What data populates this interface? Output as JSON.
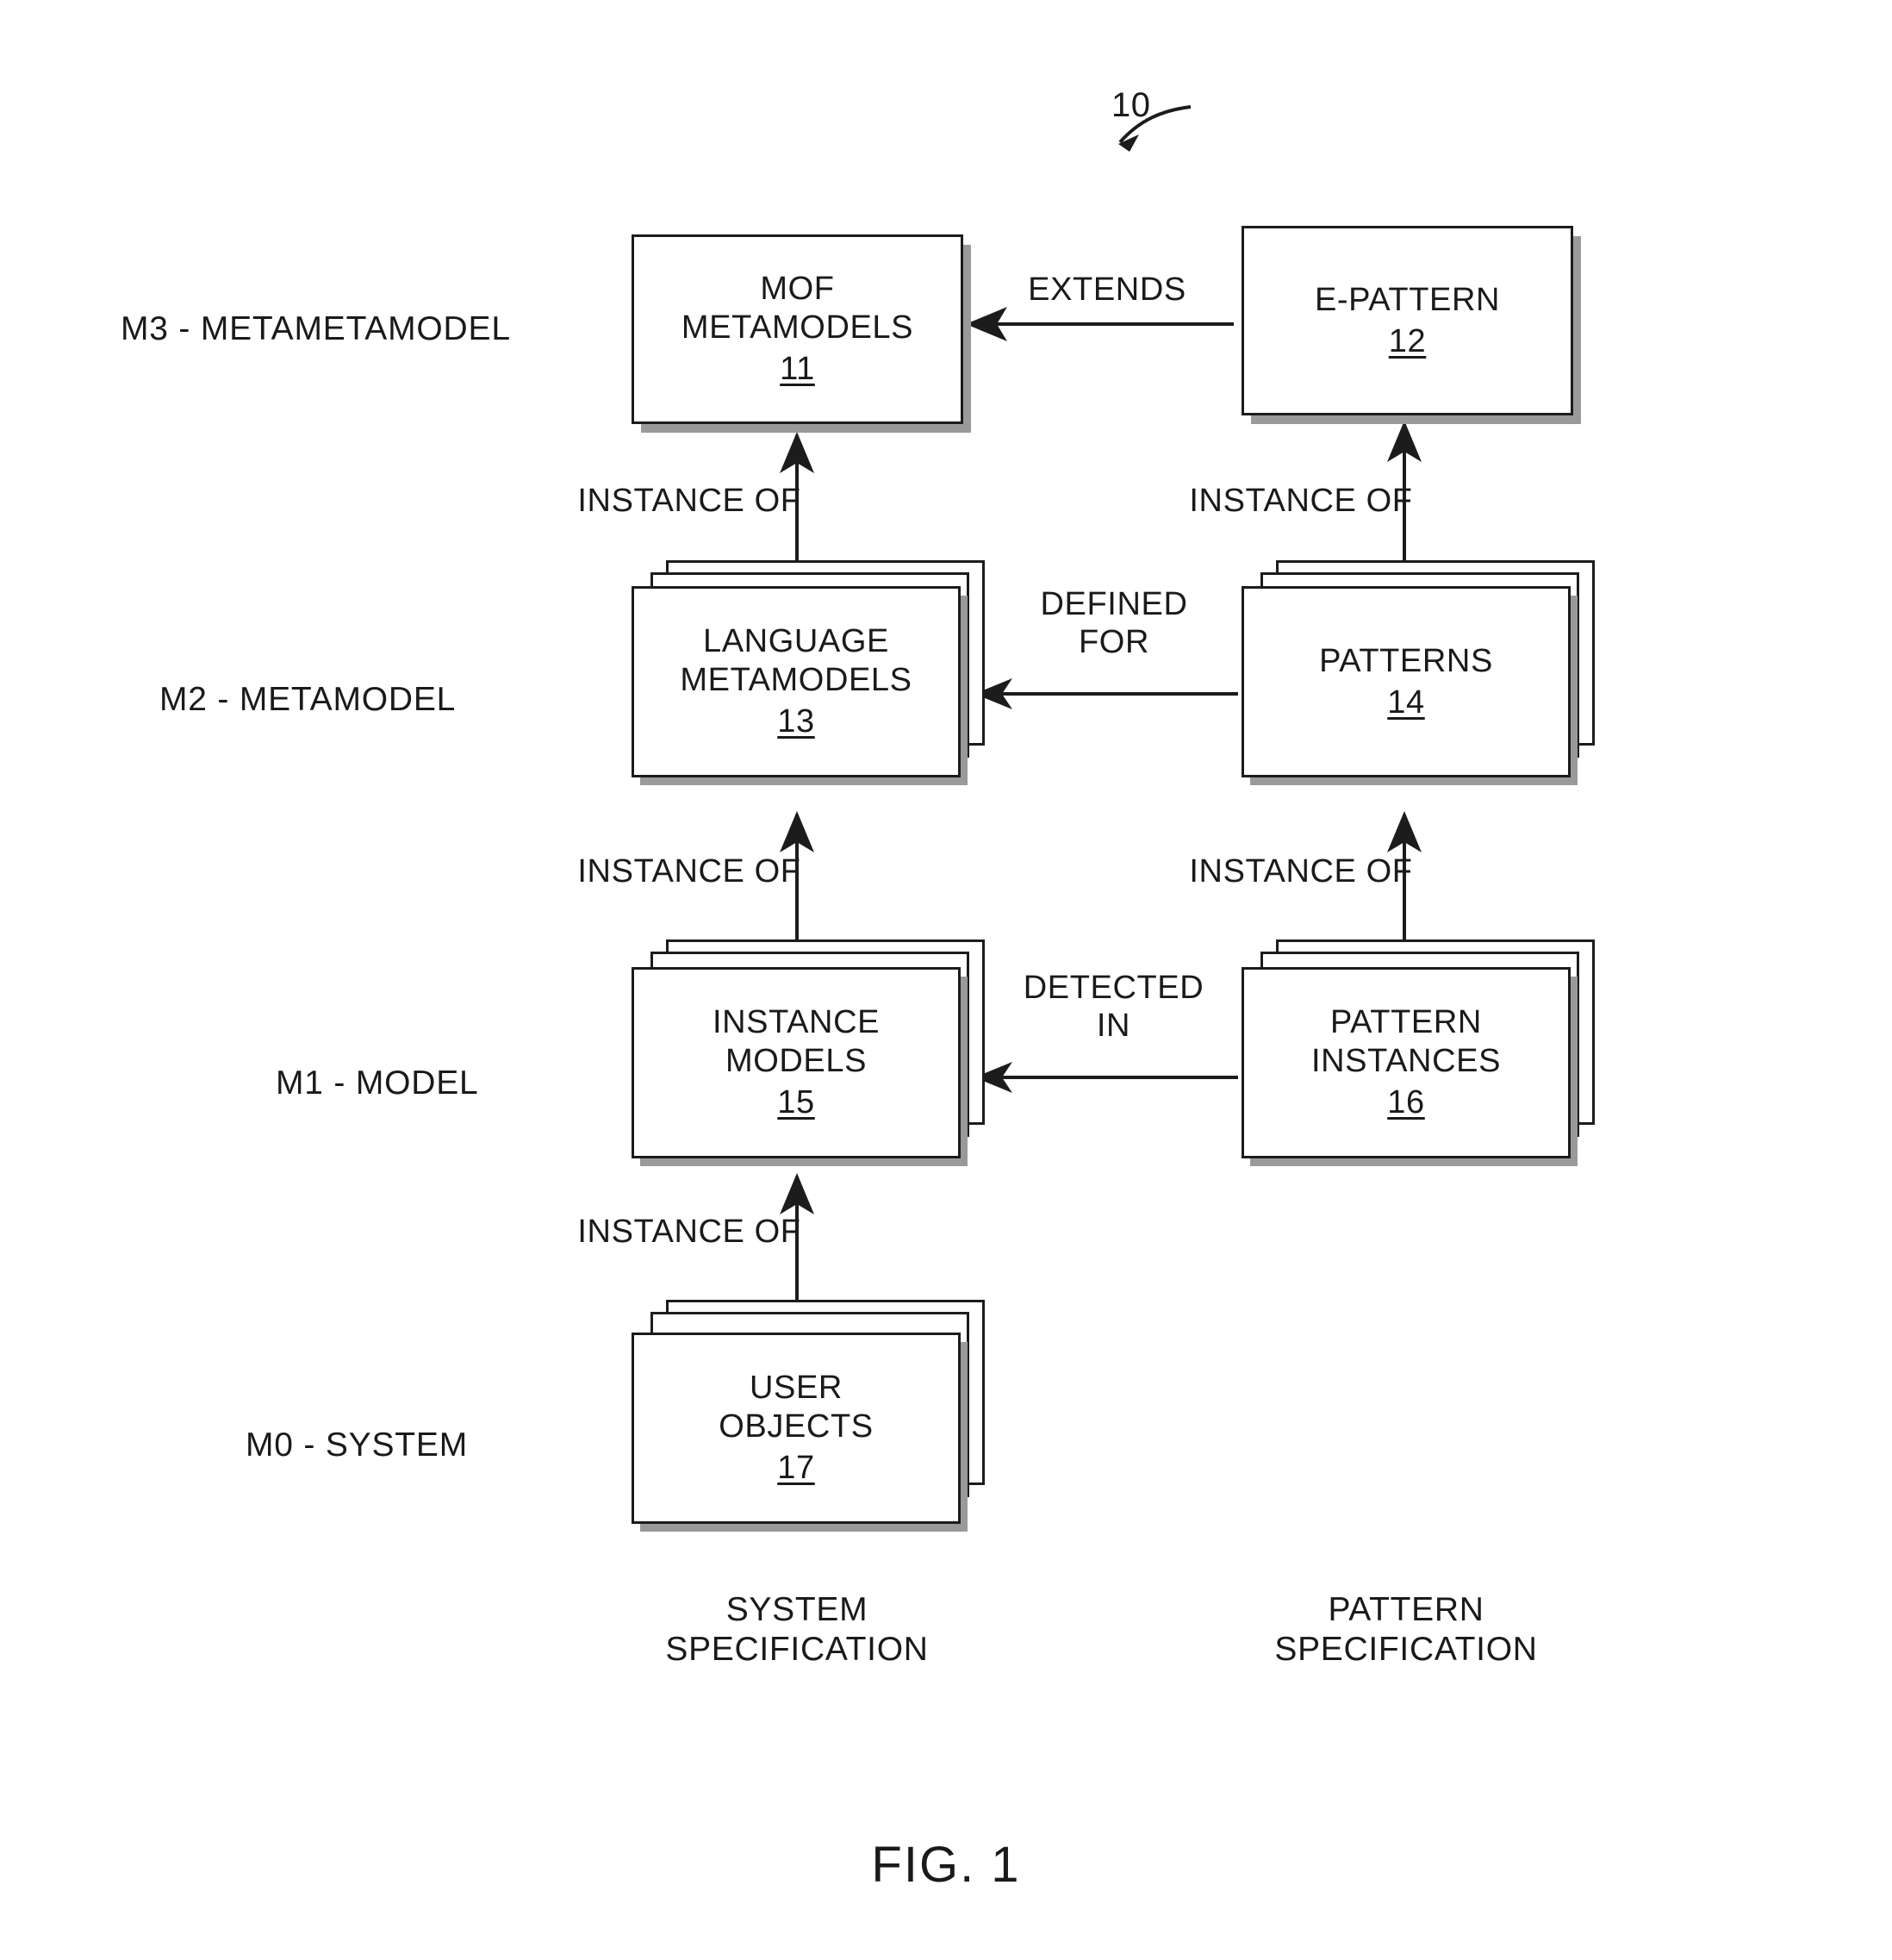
{
  "figure": {
    "caption": "FIG. 1",
    "reference_numeral": "10"
  },
  "levels": [
    {
      "id": "m3",
      "label": "M3 - METAMETAMODEL"
    },
    {
      "id": "m2",
      "label": "M2 - METAMODEL"
    },
    {
      "id": "m1",
      "label": "M1 - MODEL"
    },
    {
      "id": "m0",
      "label": "M0 - SYSTEM"
    }
  ],
  "nodes": [
    {
      "id": "mof-metamodels",
      "lines": [
        "MOF",
        "METAMODELS"
      ],
      "numeral": "11",
      "stacked": false
    },
    {
      "id": "e-pattern",
      "lines": [
        "E-PATTERN"
      ],
      "numeral": "12",
      "stacked": false
    },
    {
      "id": "language-metamodels",
      "lines": [
        "LANGUAGE",
        "METAMODELS"
      ],
      "numeral": "13",
      "stacked": true
    },
    {
      "id": "patterns",
      "lines": [
        "PATTERNS"
      ],
      "numeral": "14",
      "stacked": true
    },
    {
      "id": "instance-models",
      "lines": [
        "INSTANCE",
        "MODELS"
      ],
      "numeral": "15",
      "stacked": true
    },
    {
      "id": "pattern-instances",
      "lines": [
        "PATTERN",
        "INSTANCES"
      ],
      "numeral": "16",
      "stacked": true
    },
    {
      "id": "user-objects",
      "lines": [
        "USER",
        "OBJECTS"
      ],
      "numeral": "17",
      "stacked": true
    }
  ],
  "edges": [
    {
      "id": "extends",
      "label": "EXTENDS",
      "from": "e-pattern",
      "to": "mof-metamodels"
    },
    {
      "id": "instance-of-left-1",
      "label": "INSTANCE OF",
      "from": "language-metamodels",
      "to": "mof-metamodels"
    },
    {
      "id": "instance-of-right-1",
      "label": "INSTANCE OF",
      "from": "patterns",
      "to": "e-pattern"
    },
    {
      "id": "defined-for",
      "label": "DEFINED\nFOR",
      "from": "patterns",
      "to": "language-metamodels"
    },
    {
      "id": "instance-of-left-2",
      "label": "INSTANCE OF",
      "from": "instance-models",
      "to": "language-metamodels"
    },
    {
      "id": "instance-of-right-2",
      "label": "INSTANCE OF",
      "from": "pattern-instances",
      "to": "patterns"
    },
    {
      "id": "detected-in",
      "label": "DETECTED\nIN",
      "from": "pattern-instances",
      "to": "instance-models"
    },
    {
      "id": "instance-of-left-3",
      "label": "INSTANCE OF",
      "from": "user-objects",
      "to": "instance-models"
    }
  ],
  "column_captions": [
    {
      "id": "system-specification",
      "label": "SYSTEM\nSPECIFICATION"
    },
    {
      "id": "pattern-specification",
      "label": "PATTERN\nSPECIFICATION"
    }
  ],
  "colors": {
    "stroke": "#1c1c1c",
    "shadow": "#9a9a9a",
    "background": "#ffffff",
    "text": "#1a1a1a"
  }
}
